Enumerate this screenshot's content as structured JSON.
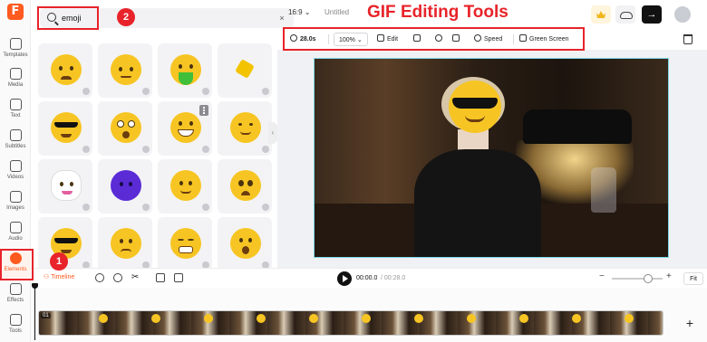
{
  "app": {
    "logo_letter": "F"
  },
  "rail": {
    "items": [
      {
        "label": "Templates",
        "icon": "templates-icon"
      },
      {
        "label": "Media",
        "icon": "media-icon"
      },
      {
        "label": "Text",
        "icon": "text-icon"
      },
      {
        "label": "Subtitles",
        "icon": "subtitles-icon"
      },
      {
        "label": "Videos",
        "icon": "videos-icon"
      },
      {
        "label": "Images",
        "icon": "images-icon"
      },
      {
        "label": "Audio",
        "icon": "audio-icon"
      },
      {
        "label": "Elements",
        "icon": "elements-icon",
        "active": true
      },
      {
        "label": "Effects",
        "icon": "effects-icon"
      },
      {
        "label": "Tools",
        "icon": "tools-icon"
      }
    ]
  },
  "search": {
    "value": "emoji",
    "clear_glyph": "×"
  },
  "emoji_grid": [
    {
      "kind": "sad",
      "more": false
    },
    {
      "kind": "angry",
      "more": false
    },
    {
      "kind": "sick",
      "more": false
    },
    {
      "kind": "party",
      "more": false
    },
    {
      "kind": "sunglasses",
      "more": false
    },
    {
      "kind": "shocked",
      "more": false
    },
    {
      "kind": "grin",
      "more": true
    },
    {
      "kind": "smile",
      "more": false
    },
    {
      "kind": "sticker",
      "more": false
    },
    {
      "kind": "purple",
      "more": false
    },
    {
      "kind": "slight-smile",
      "more": false
    },
    {
      "kind": "worried",
      "more": false
    },
    {
      "kind": "sunglasses",
      "more": false
    },
    {
      "kind": "frown",
      "more": false
    },
    {
      "kind": "tired",
      "more": false
    },
    {
      "kind": "surprised",
      "more": false
    }
  ],
  "header": {
    "ratio": "16:9",
    "doc_title": "Untitled",
    "overlay_title": "GIF Editing Tools",
    "export_glyph": "→"
  },
  "toolbar": {
    "duration": "28.0s",
    "zoom": "100%",
    "edit": "Edit",
    "speed": "Speed",
    "green_screen": "Green Screen"
  },
  "timeline": {
    "tab": "Timeline",
    "current": "00:00.0",
    "total": "/ 00:28.0",
    "fit": "Fit",
    "clip_badge": "01",
    "zoom_level": 0.72
  },
  "annotations": {
    "step1": "1",
    "step2": "2"
  },
  "colors": {
    "accent": "#ff5a1f",
    "annotation": "#e8232a",
    "selection": "#7ad7e6"
  }
}
